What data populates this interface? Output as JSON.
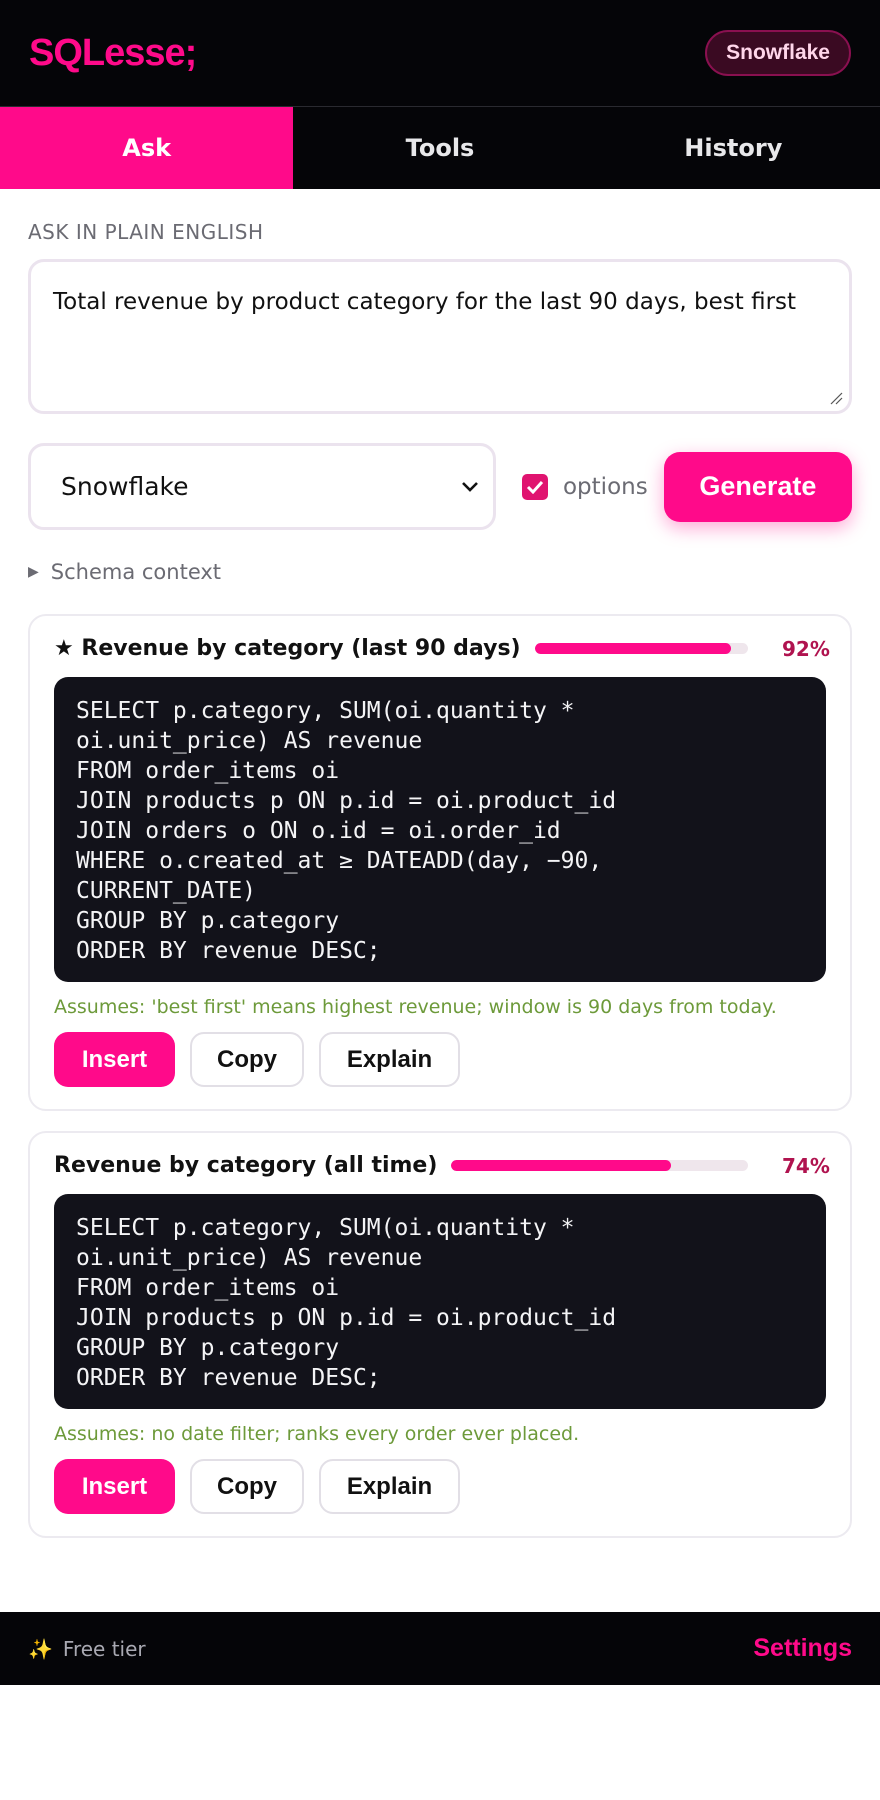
{
  "app": {
    "logo": "SQLesse;",
    "dialect_badge": "Snowflake"
  },
  "tabs": [
    {
      "label": "Ask",
      "active": true
    },
    {
      "label": "Tools",
      "active": false
    },
    {
      "label": "History",
      "active": false
    }
  ],
  "ask": {
    "section_label": "ASK IN PLAIN ENGLISH",
    "prompt_value": "Total revenue by product category for the last 90 days, best first",
    "dialect_selected": "Snowflake",
    "options_checked": true,
    "options_label": "options",
    "generate_label": "Generate",
    "schema_context_label": "Schema context"
  },
  "results": [
    {
      "title": "★ Revenue by category (last 90 days)",
      "confidence": 0.92,
      "confidence_label": "92%",
      "sql": "SELECT p.category, SUM(oi.quantity *\noi.unit_price) AS revenue\nFROM order_items oi\nJOIN products p ON p.id = oi.product_id\nJOIN orders o ON o.id = oi.order_id\nWHERE o.created_at ≥ DATEADD(day, −90,\nCURRENT_DATE)\nGROUP BY p.category\nORDER BY revenue DESC;",
      "assumption": "Assumes: 'best first' means highest revenue; window is 90 days from today.",
      "insert_label": "Insert",
      "copy_label": "Copy",
      "explain_label": "Explain"
    },
    {
      "title": "Revenue by category (all time)",
      "confidence": 0.74,
      "confidence_label": "74%",
      "sql": "SELECT p.category, SUM(oi.quantity *\noi.unit_price) AS revenue\nFROM order_items oi\nJOIN products p ON p.id = oi.product_id\nGROUP BY p.category\nORDER BY revenue DESC;",
      "assumption": "Assumes: no date filter; ranks every order ever placed.",
      "insert_label": "Insert",
      "copy_label": "Copy",
      "explain_label": "Explain"
    }
  ],
  "footer": {
    "tier_icon": "sparkles-icon",
    "tier_label": "Free tier",
    "settings_label": "Settings"
  },
  "colors": {
    "accent": "#ff0a8a",
    "dark": "#050508",
    "code_bg": "#12121a",
    "assumption": "#6d9a3a"
  }
}
